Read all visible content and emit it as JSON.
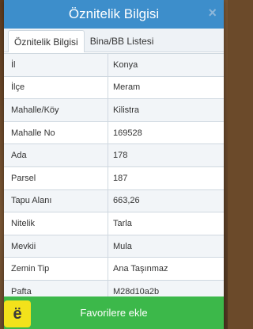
{
  "header": {
    "title": "Öznitelik Bilgisi",
    "close_icon": "×"
  },
  "tabs": [
    {
      "label": "Öznitelik Bilgisi",
      "active": true
    },
    {
      "label": "Bina/BB Listesi",
      "active": false
    }
  ],
  "rows": [
    {
      "label": "İl",
      "value": "Konya"
    },
    {
      "label": "İlçe",
      "value": "Meram"
    },
    {
      "label": "Mahalle/Köy",
      "value": "Kilistra"
    },
    {
      "label": "Mahalle No",
      "value": "169528"
    },
    {
      "label": "Ada",
      "value": "178"
    },
    {
      "label": "Parsel",
      "value": "187"
    },
    {
      "label": "Tapu Alanı",
      "value": "663,26"
    },
    {
      "label": "Nitelik",
      "value": "Tarla"
    },
    {
      "label": "Mevkii",
      "value": "Mula"
    },
    {
      "label": "Zemin Tip",
      "value": "Ana Taşınmaz"
    },
    {
      "label": "Pafta",
      "value": "M28d10a2b"
    }
  ],
  "footer": {
    "button_label": "Favorilere ekle"
  },
  "logo": {
    "glyph": "ë",
    "color": "#f3e21b"
  },
  "colors": {
    "header": "#3d8ecb",
    "button": "#3cb84a"
  }
}
